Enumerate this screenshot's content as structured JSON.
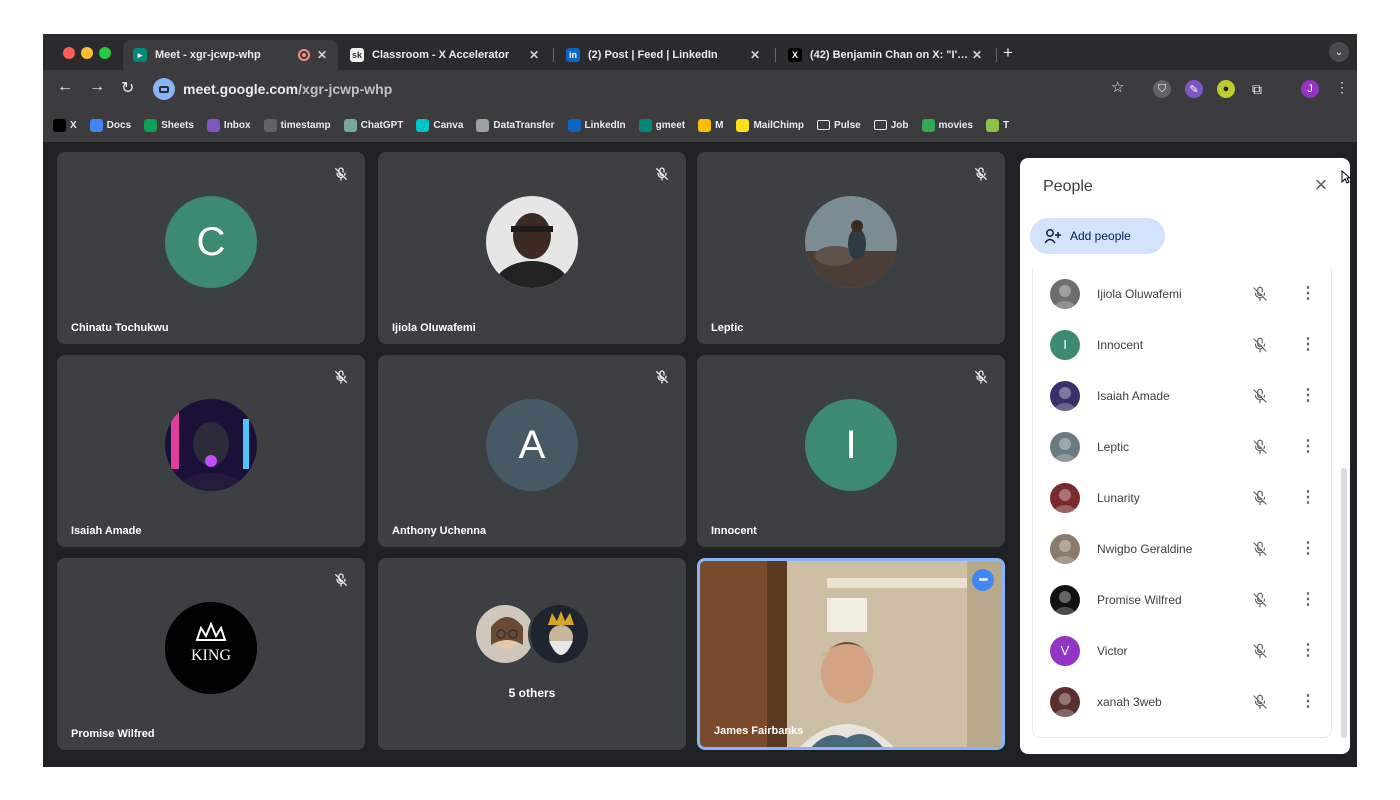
{
  "browser": {
    "tabs": [
      {
        "title": "Meet - xgr-jcwp-whp",
        "icon": "meet-icon",
        "recording": true
      },
      {
        "title": "Classroom - X Accelerator",
        "icon": "classroom-icon"
      },
      {
        "title": "(2) Post | Feed | LinkedIn",
        "icon": "linkedin-icon"
      },
      {
        "title": "(42) Benjamin Chan on X: \"I'…",
        "icon": "x-icon"
      }
    ],
    "url_host": "meet.google.com",
    "url_path": "/xgr-jcwp-whp",
    "bookmarks": [
      {
        "label": "X",
        "icon": "x-icon",
        "color": "#000000"
      },
      {
        "label": "Docs",
        "icon": "docs-icon",
        "color": "#4285f4"
      },
      {
        "label": "Sheets",
        "icon": "sheets-icon",
        "color": "#0f9d58"
      },
      {
        "label": "Inbox",
        "icon": "inbox-icon",
        "color": "#7e57c2"
      },
      {
        "label": "timestamp",
        "icon": "globe-icon",
        "color": "#5f6368"
      },
      {
        "label": "ChatGPT",
        "icon": "chatgpt-icon",
        "color": "#74aa9c"
      },
      {
        "label": "Canva",
        "icon": "canva-icon",
        "color": "#00c4cc"
      },
      {
        "label": "DataTransfer",
        "icon": "datatransfer-icon",
        "color": "#9aa0a6"
      },
      {
        "label": "LinkedIn",
        "icon": "linkedin-icon",
        "color": "#0a66c2"
      },
      {
        "label": "gmeet",
        "icon": "meet-icon",
        "color": "#00897b"
      },
      {
        "label": "M",
        "icon": "m-icon",
        "color": "#fbbc04"
      },
      {
        "label": "MailChimp",
        "icon": "mailchimp-icon",
        "color": "#ffe01b"
      },
      {
        "label": "Pulse",
        "icon": "folder-icon",
        "color": "#3c3c3f"
      },
      {
        "label": "Job",
        "icon": "folder-icon",
        "color": "#3c3c3f"
      },
      {
        "label": "movies",
        "icon": "movies-icon",
        "color": "#34a853"
      },
      {
        "label": "T",
        "icon": "t-icon",
        "color": "#8bc34a"
      }
    ],
    "profile_initial": "J"
  },
  "tiles": [
    {
      "name": "Chinatu Tochukwu",
      "avatar_letter": "C",
      "avatar_color": "#3d8a72",
      "muted": true
    },
    {
      "name": "Ijiola Oluwafemi",
      "avatar": "photo-portrait",
      "muted": true
    },
    {
      "name": "Leptic",
      "avatar": "photo-rocks",
      "muted": true
    },
    {
      "name": "Isaiah Amade",
      "avatar": "photo-neon",
      "muted": true
    },
    {
      "name": "Anthony Uchenna",
      "avatar_letter": "A",
      "avatar_color": "#455a64",
      "muted": true
    },
    {
      "name": "Innocent",
      "avatar_letter": "I",
      "avatar_color": "#3d8a72",
      "muted": true
    },
    {
      "name": "Promise Wilfred",
      "avatar": "photo-king",
      "avatar_text": "KING",
      "muted": true
    },
    {
      "name": "",
      "others_label": "5 others"
    },
    {
      "name": "James Fairbanks",
      "avatar": "self-video"
    }
  ],
  "people_panel": {
    "title": "People",
    "add_label": "Add people",
    "participants": [
      {
        "name": "Ijiola Oluwafemi",
        "avatar_color": "#6d6d6d"
      },
      {
        "name": "Innocent",
        "avatar_letter": "I",
        "avatar_color": "#3d8a72"
      },
      {
        "name": "Isaiah Amade",
        "avatar_color": "#3a2f6b"
      },
      {
        "name": "Leptic",
        "avatar_color": "#6b7a80"
      },
      {
        "name": "Lunarity",
        "avatar_color": "#7a2b2b"
      },
      {
        "name": "Nwigbo Geraldine",
        "avatar_color": "#8a7a6a"
      },
      {
        "name": "Promise Wilfred",
        "avatar_color": "#111111"
      },
      {
        "name": "Victor",
        "avatar_letter": "V",
        "avatar_color": "#9334c4"
      },
      {
        "name": "xanah 3web",
        "avatar_color": "#5a2f2f"
      }
    ]
  }
}
